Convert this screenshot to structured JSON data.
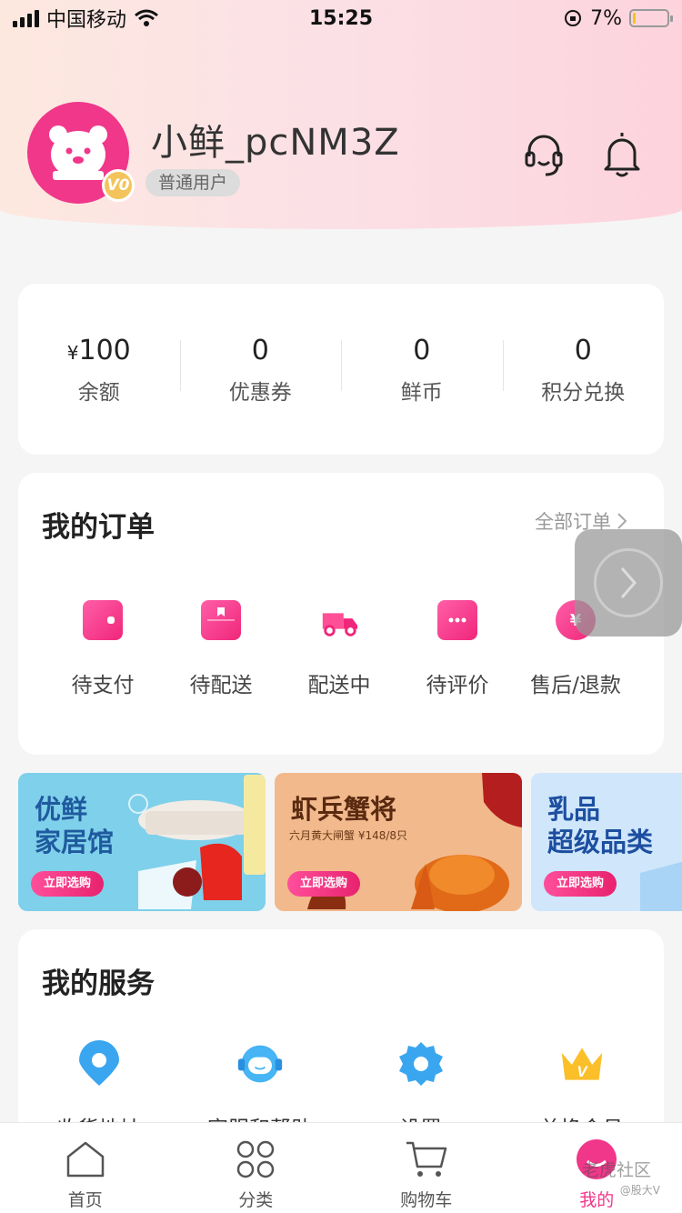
{
  "status_bar": {
    "carrier": "中国移动",
    "time": "15:25",
    "battery": "7%",
    "battery_level": 0.07
  },
  "profile": {
    "username": "小鲜_pcNM3Z",
    "level": "普通用户",
    "vip_badge": "V0"
  },
  "header_icons": [
    "headset-icon",
    "bell-icon"
  ],
  "stats": [
    {
      "currency": "¥",
      "value": "100",
      "label": "余额"
    },
    {
      "currency": "",
      "value": "0",
      "label": "优惠券"
    },
    {
      "currency": "",
      "value": "0",
      "label": "鲜币"
    },
    {
      "currency": "",
      "value": "0",
      "label": "积分兑换"
    }
  ],
  "orders": {
    "title": "我的订单",
    "all_label": "全部订单",
    "items": [
      {
        "label": "待支付",
        "icon": "wallet-icon"
      },
      {
        "label": "待配送",
        "icon": "package-icon"
      },
      {
        "label": "配送中",
        "icon": "truck-icon"
      },
      {
        "label": "待评价",
        "icon": "comment-icon"
      },
      {
        "label": "售后/退款",
        "icon": "refund-icon"
      }
    ]
  },
  "banners": [
    {
      "title_line1": "优鲜",
      "title_line2": "家居馆",
      "subtitle": "",
      "button": "立即选购",
      "bg": "#7fd0ea",
      "title_color": "#1f5a9e"
    },
    {
      "title_line1": "虾兵蟹将",
      "title_line2": "",
      "subtitle": "六月黄大闸蟹 ¥148/8只",
      "button": "立即选购",
      "bg": "#f2b98c",
      "title_color": "#5a2a10"
    },
    {
      "title_line1": "乳品",
      "title_line2": "超级品类",
      "subtitle": "",
      "button": "立即选购",
      "bg": "#cfe6fb",
      "title_color": "#1d4fa0"
    }
  ],
  "services": {
    "title": "我的服务",
    "items": [
      {
        "label": "收货地址",
        "icon": "location-icon"
      },
      {
        "label": "客服和帮助",
        "icon": "support-icon"
      },
      {
        "label": "设置",
        "icon": "settings-gear-icon"
      },
      {
        "label": "兑换会员",
        "icon": "crown-icon"
      }
    ]
  },
  "tabbar": [
    {
      "label": "首页",
      "icon": "home-icon",
      "active": false
    },
    {
      "label": "分类",
      "icon": "category-icon",
      "active": false
    },
    {
      "label": "购物车",
      "icon": "cart-icon",
      "active": false
    },
    {
      "label": "我的",
      "icon": "profile-icon",
      "active": true
    }
  ],
  "watermark": {
    "text": "老虎社区",
    "sub": "@股大V"
  },
  "colors": {
    "accent": "#f0378a",
    "header_gradient_start": "#fde8df",
    "header_gradient_end": "#fdd3dd"
  }
}
